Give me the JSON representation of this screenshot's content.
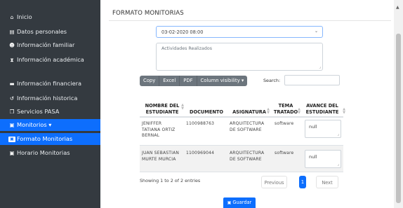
{
  "sidebar": {
    "items": [
      {
        "label": "Inicio",
        "icon": "home-icon"
      },
      {
        "label": "Datos personales",
        "icon": "id-card-icon"
      },
      {
        "label": "Información familiar",
        "icon": "users-icon"
      },
      {
        "label": "Información académica",
        "icon": "hourglass-icon"
      },
      {
        "label": "Información financiera",
        "icon": "money-icon"
      },
      {
        "label": "Información historica",
        "icon": "history-icon"
      },
      {
        "label": "Servicios PASA",
        "icon": "copy-icon"
      },
      {
        "label": "Monitorios ▾",
        "icon": "card-icon"
      },
      {
        "label": "Formato Monitorias",
        "icon": "card-icon"
      },
      {
        "label": "Horario Monitorias",
        "icon": "card-icon"
      }
    ]
  },
  "main": {
    "title": "FORMATO MONITORIAS",
    "date_value": "03-02-2020 08:00",
    "activities_placeholder": "Actividades Realizados",
    "toolbar": {
      "copy": "Copy",
      "excel": "Excel",
      "pdf": "PDF",
      "column_visibility": "Column visibility ▾"
    },
    "search_label": "Search:",
    "table": {
      "headers": [
        "NOMBRE DEL ESTUDIANTE",
        "DOCUMENTO",
        "ASIGNATURA",
        "TEMA TRATADO",
        "AVANCE DEL ESTUDIANTE"
      ],
      "rows": [
        {
          "nombre": "JENIFFER TATIANA ORTIZ BERNAL",
          "documento": "1100988763",
          "asignatura": "ARQUITECTURA DE SOFTWARE",
          "tema": "software",
          "avance": "null"
        },
        {
          "nombre": "JUAN SEBASTIAN MURTE MURCIA",
          "documento": "1100969044",
          "asignatura": "ARQUITECTURA DE SOFTWARE",
          "tema": "software",
          "avance": "null"
        }
      ]
    },
    "info": "Showing 1 to 2 of 2 entries",
    "pagination": {
      "previous": "Previous",
      "current": "1",
      "next": "Next"
    },
    "save_label": "Guardar"
  },
  "colors": {
    "sidebar_bg": "#343a40",
    "accent": "#0d6efd",
    "toolbar_btn": "#6c757d"
  }
}
